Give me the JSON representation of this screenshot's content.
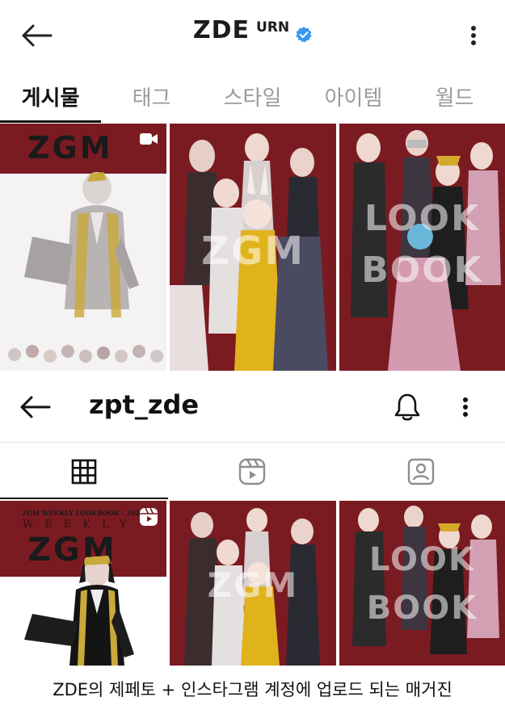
{
  "profile_header": {
    "title": "ZDE",
    "title_superscript": "URN",
    "back_icon": "arrow-left-icon",
    "verified_icon": "verified-badge-icon",
    "more_icon": "more-vertical-icon"
  },
  "profile_tabs": [
    {
      "label": "게시물",
      "active": true
    },
    {
      "label": "태그",
      "active": false
    },
    {
      "label": "스타일",
      "active": false
    },
    {
      "label": "아이템",
      "active": false
    },
    {
      "label": "월드",
      "active": false
    }
  ],
  "grid_top": {
    "tiles": [
      {
        "logo": "ZGM",
        "badge": "video-icon"
      },
      {
        "overlay": "ZGM"
      },
      {
        "overlay_line1": "LOOK",
        "overlay_line2": "BOOK"
      }
    ]
  },
  "account_header": {
    "username": "zpt_zde",
    "back_icon": "arrow-left-icon",
    "bell_icon": "bell-icon",
    "more_icon": "more-vertical-icon"
  },
  "account_tabs": [
    {
      "icon": "grid-icon",
      "active": true
    },
    {
      "icon": "reels-icon",
      "active": false
    },
    {
      "icon": "tagged-user-icon",
      "active": false
    }
  ],
  "grid_bottom": {
    "tiles": [
      {
        "small_header": "ZGM WEEKLY LOOKBOOK · 2024",
        "weekly": "WEEKLY",
        "logo": "ZGM",
        "badge": "reels-icon"
      },
      {
        "overlay": "ZGM"
      },
      {
        "overlay_line1": "LOOK",
        "overlay_line2": "BOOK"
      }
    ]
  },
  "caption": "ZDE의 제페토 + 인스타그램 계정에 업로드 되는 매거진",
  "colors": {
    "accent_verified": "#3897f0",
    "maroon": "#7a1b22",
    "inactive_tab": "#9a9a9a"
  }
}
